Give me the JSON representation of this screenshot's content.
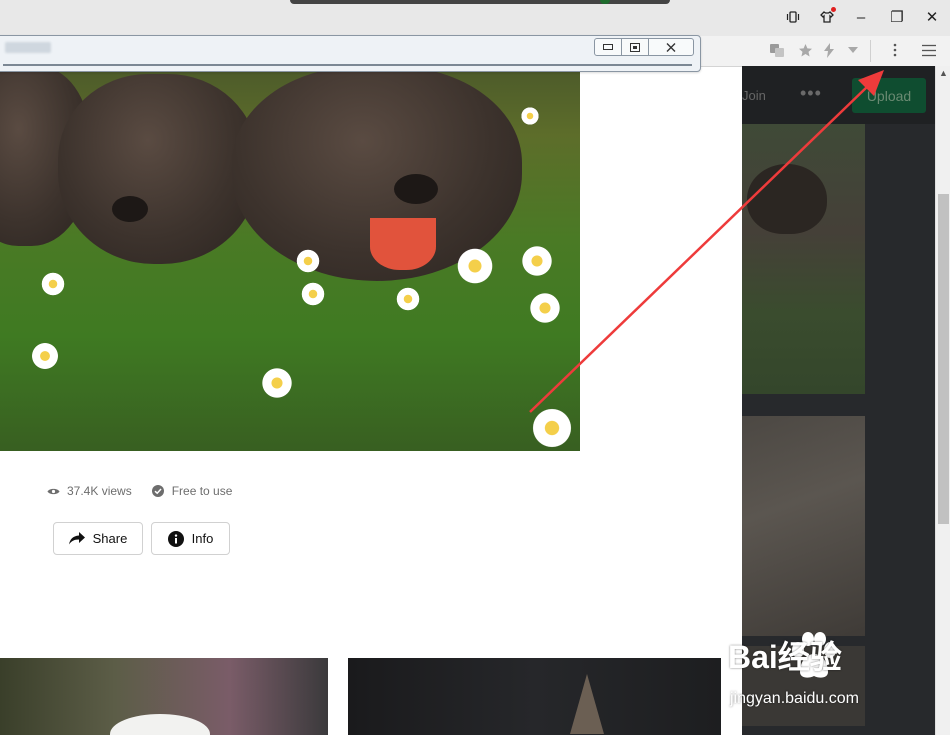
{
  "window_controls": {
    "minimize": "–",
    "restore": "❐",
    "close": "✕"
  },
  "stats": {
    "views": "37.4K views",
    "license": "Free to use"
  },
  "actions": {
    "share_label": "Share",
    "info_label": "Info"
  },
  "site_header": {
    "join_label": "Join",
    "more_label": "•••",
    "upload_label": "Upload"
  },
  "watermark": {
    "brand": "Bai经验",
    "url": "jingyan.baidu.com"
  },
  "colors": {
    "annotation_arrow": "#ee3b3b",
    "upload_button_bg": "#0f4d30",
    "page_bg": "#ffffff"
  }
}
